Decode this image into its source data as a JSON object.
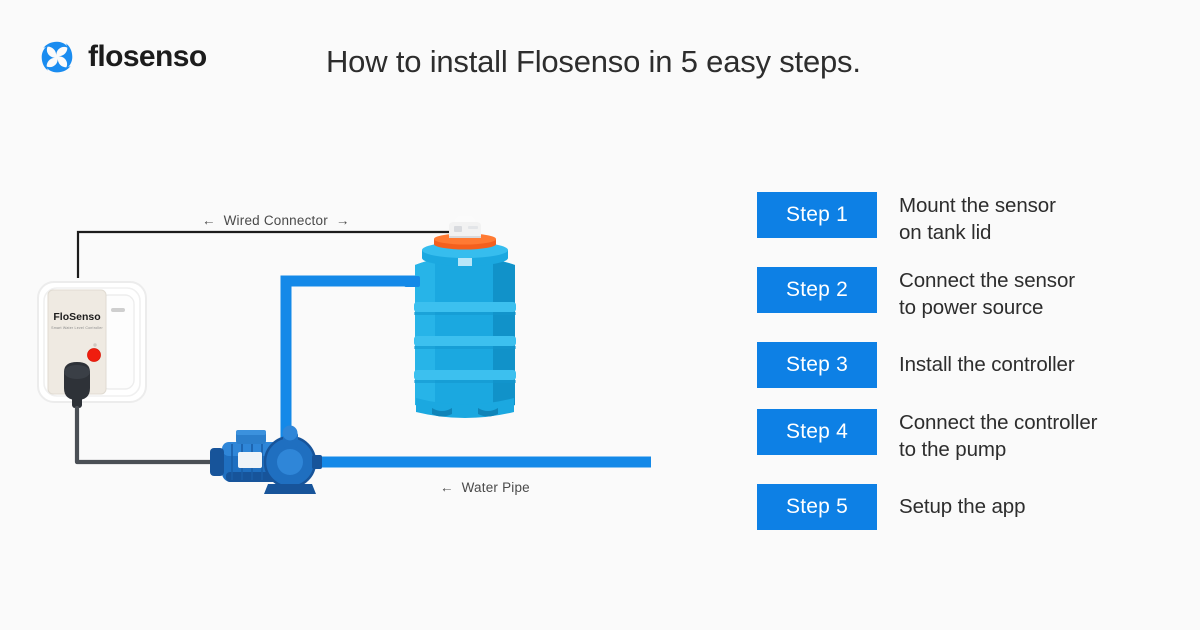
{
  "brand": {
    "name": "flosenso",
    "logo_icon": "swirl-pinwheel-icon",
    "accent_color": "#1a8cf0"
  },
  "header": {
    "title": "How to install Flosenso in 5 easy steps."
  },
  "diagram": {
    "labels": {
      "wired_connector": "Wired Connector",
      "water_pipe": "Water Pipe",
      "arrow_left": "←",
      "arrow_right": "→"
    },
    "controller": {
      "brand_label": "FloSenso",
      "sub_label": "Smart Water Level Controller",
      "led_color": "#f01d0e",
      "body_color": "#efeae2"
    },
    "tank": {
      "body_color": "#1ba8e0",
      "lid_color": "#1ba8e0",
      "sensor_base_color": "#f4601d",
      "sensor_color": "#f2f2f2"
    },
    "pump": {
      "body_color": "#1464b4"
    },
    "pipe": {
      "color": "#1489e8"
    },
    "wire": {
      "color": "#1c1c1c",
      "cable_color": "#4a4f55"
    }
  },
  "steps": {
    "badge_color": "#0d80e5",
    "items": [
      {
        "badge": "Step 1",
        "lines": [
          "Mount the sensor",
          "on tank lid"
        ]
      },
      {
        "badge": "Step 2",
        "lines": [
          "Connect the sensor",
          "to power source"
        ]
      },
      {
        "badge": "Step 3",
        "lines": [
          "Install the controller"
        ]
      },
      {
        "badge": "Step 4",
        "lines": [
          "Connect the controller",
          "to the pump"
        ]
      },
      {
        "badge": "Step 5",
        "lines": [
          "Setup the app"
        ]
      }
    ]
  }
}
